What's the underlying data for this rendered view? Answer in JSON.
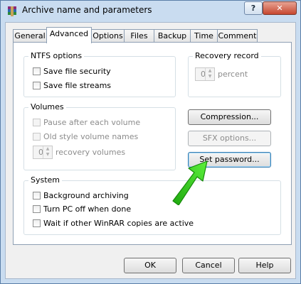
{
  "window": {
    "title": "Archive name and parameters",
    "help_label": "?",
    "close_label": "✕"
  },
  "tabs": [
    {
      "label": "General",
      "active": false
    },
    {
      "label": "Advanced",
      "active": true
    },
    {
      "label": "Options",
      "active": false
    },
    {
      "label": "Files",
      "active": false
    },
    {
      "label": "Backup",
      "active": false
    },
    {
      "label": "Time",
      "active": false
    },
    {
      "label": "Comment",
      "active": false
    }
  ],
  "ntfs": {
    "title": "NTFS options",
    "save_security": "Save file security",
    "save_streams": "Save file streams"
  },
  "recovery_record": {
    "title": "Recovery record",
    "value": "0",
    "unit": "percent"
  },
  "volumes": {
    "title": "Volumes",
    "pause": "Pause after each volume",
    "old_style": "Old style volume names",
    "recovery_value": "0",
    "recovery_label": "recovery volumes"
  },
  "side_buttons": {
    "compression": "Compression...",
    "sfx": "SFX options...",
    "password": "Set password..."
  },
  "system": {
    "title": "System",
    "background": "Background archiving",
    "turn_off": "Turn PC off when done",
    "wait": "Wait if other WinRAR copies are active"
  },
  "footer": {
    "ok": "OK",
    "cancel": "Cancel",
    "help": "Help"
  },
  "colors": {
    "annotation_arrow": "#2ecc1a"
  }
}
